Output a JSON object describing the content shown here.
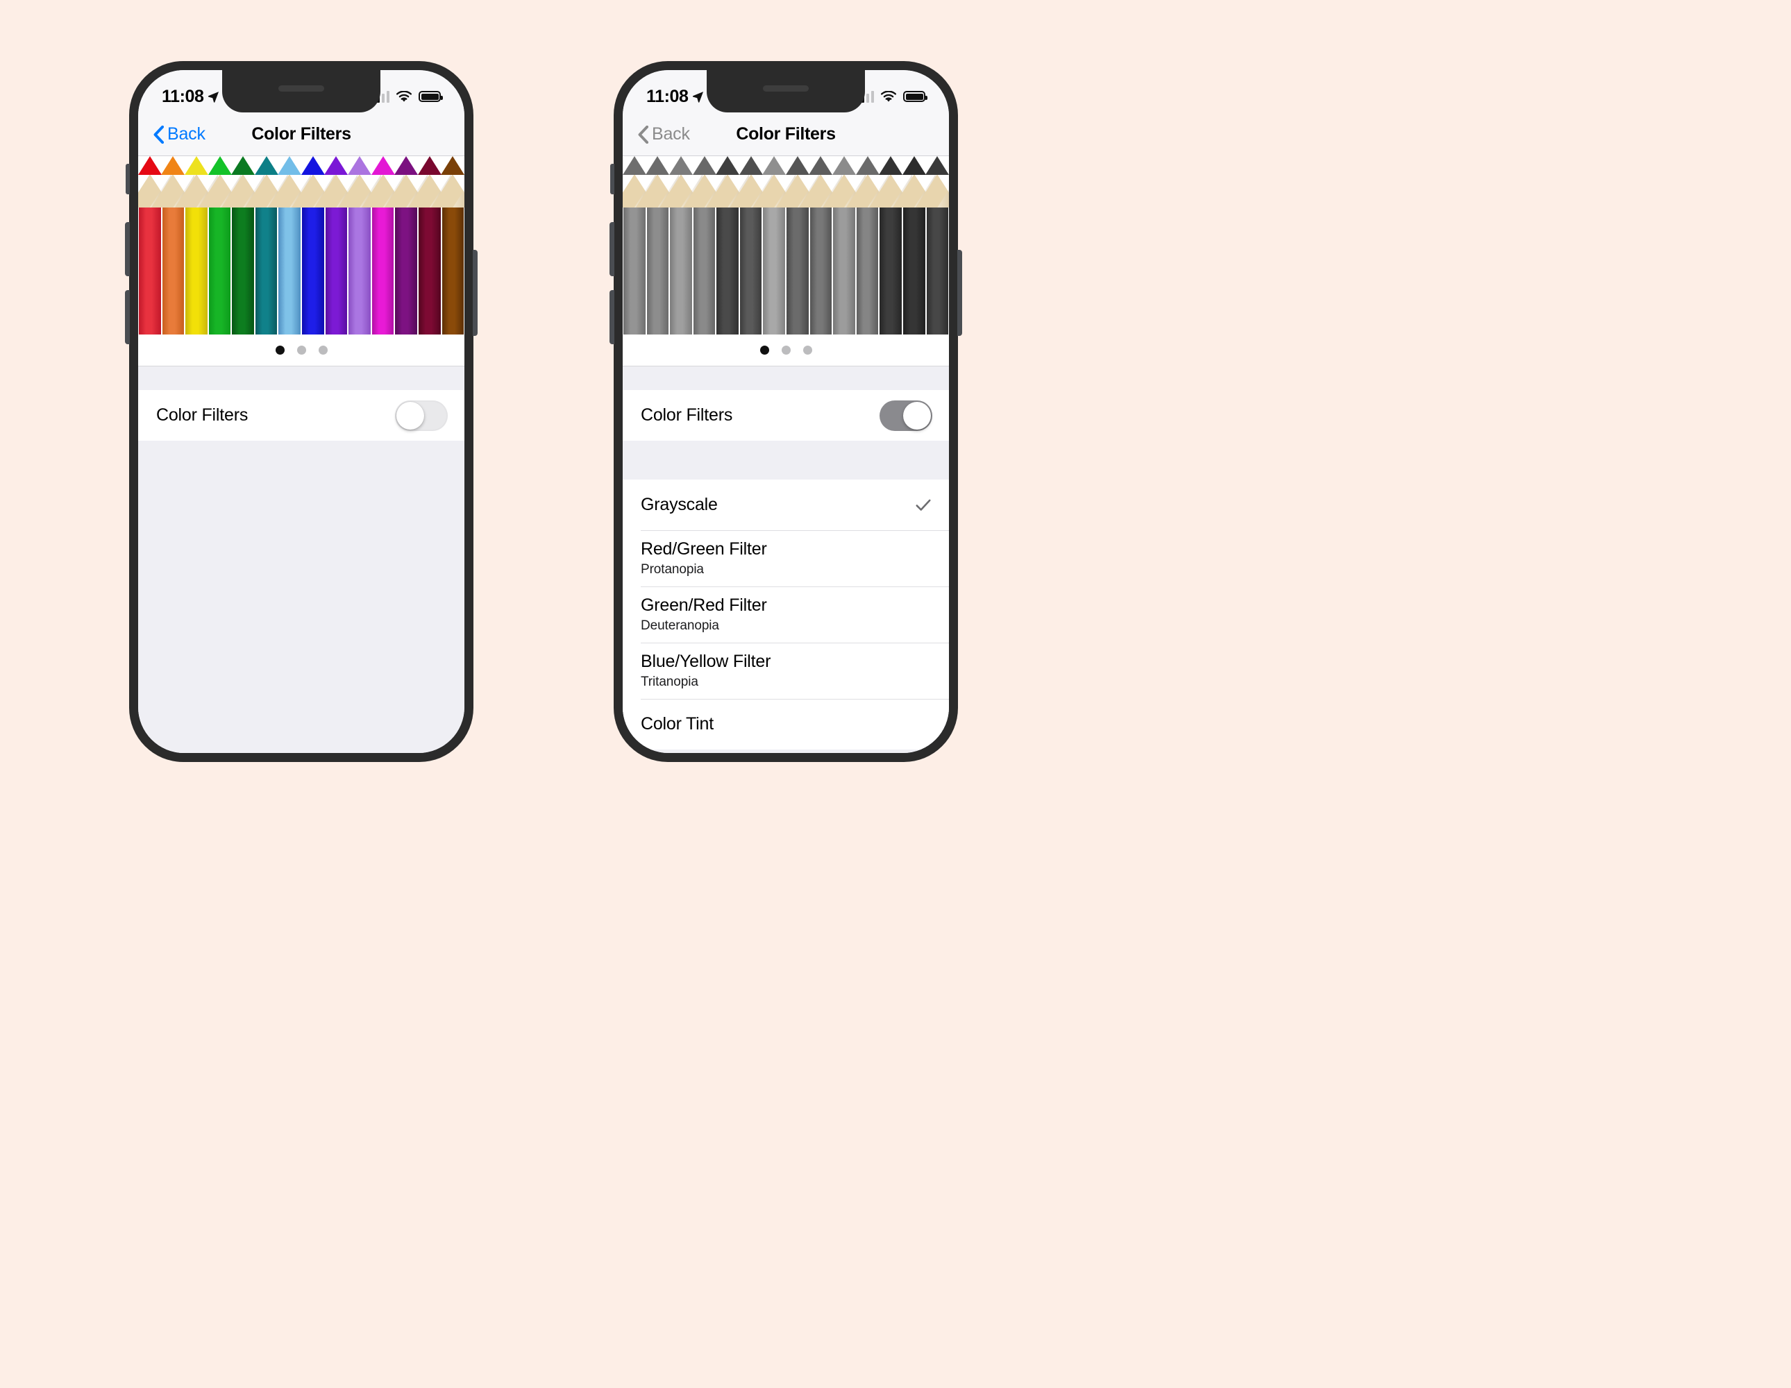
{
  "background_color": "#fdeee6",
  "phones": [
    {
      "id": "phone-color",
      "mode": "color",
      "status_bar": {
        "time": "11:08",
        "location_icon": "location-arrow-icon",
        "signal_icon": "cellular-signal-icon",
        "wifi_icon": "wifi-icon",
        "battery_icon": "battery-full-icon"
      },
      "nav": {
        "back_label": "Back",
        "back_icon": "chevron-left-icon",
        "title": "Color Filters",
        "back_color": "#007aff"
      },
      "banner": {
        "name": "color-pencils-preview",
        "page_dots": {
          "count": 3,
          "active_index": 0
        },
        "pencils": [
          {
            "name": "red",
            "tip": "#e50914",
            "body": "#e8323f",
            "body2": "#c2182a"
          },
          {
            "name": "orange",
            "tip": "#f08416",
            "body": "#e87b3a",
            "body2": "#c85f1e"
          },
          {
            "name": "yellow",
            "tip": "#ede11f",
            "body": "#f2e008",
            "body2": "#c9b70a"
          },
          {
            "name": "green",
            "tip": "#14c229",
            "body": "#17b526",
            "body2": "#0d9c1c"
          },
          {
            "name": "dark-green",
            "tip": "#0b7a22",
            "body": "#0d7d1f",
            "body2": "#075615"
          },
          {
            "name": "teal",
            "tip": "#0c7f86",
            "body": "#10818a",
            "body2": "#0a5a60"
          },
          {
            "name": "light-blue",
            "tip": "#72bde8",
            "body": "#7fc2e8",
            "body2": "#4f8fc2"
          },
          {
            "name": "blue",
            "tip": "#1414e0",
            "body": "#1e1ee8",
            "body2": "#0e0eb0"
          },
          {
            "name": "purple",
            "tip": "#7a17d6",
            "body": "#7c1ad4",
            "body2": "#5a0fa0"
          },
          {
            "name": "light-purple",
            "tip": "#ab74e0",
            "body": "#aa76e2",
            "body2": "#8a4fc4"
          },
          {
            "name": "magenta",
            "tip": "#e318d4",
            "body": "#e81ad6",
            "body2": "#b210a6"
          },
          {
            "name": "dark-purple",
            "tip": "#7b1080",
            "body": "#7d1282",
            "body2": "#550a58"
          },
          {
            "name": "maroon",
            "tip": "#79082f",
            "body": "#7d0a33",
            "body2": "#540520"
          },
          {
            "name": "brown",
            "tip": "#7a4008",
            "body": "#8a4a09",
            "body2": "#5d3005"
          }
        ]
      },
      "settings": {
        "toggle_row": {
          "label": "Color Filters",
          "enabled": false
        },
        "options": []
      }
    },
    {
      "id": "phone-grayscale",
      "mode": "grayscale",
      "status_bar": {
        "time": "11:08",
        "location_icon": "location-arrow-icon",
        "signal_icon": "cellular-signal-icon",
        "wifi_icon": "wifi-icon",
        "battery_icon": "battery-full-icon"
      },
      "nav": {
        "back_label": "Back",
        "back_icon": "chevron-left-icon",
        "title": "Color Filters",
        "back_color": "#8b8b8b"
      },
      "banner": {
        "name": "grayscale-pencils-preview",
        "page_dots": {
          "count": 3,
          "active_index": 0
        },
        "pencils": [
          {
            "name": "gray-1",
            "tip": "#6e6e6e",
            "body": "#949494",
            "body2": "#6f6f6f"
          },
          {
            "name": "gray-2",
            "tip": "#6b6b6b",
            "body": "#8d8d8d",
            "body2": "#6a6a6a"
          },
          {
            "name": "gray-3",
            "tip": "#7c7c7c",
            "body": "#9f9f9f",
            "body2": "#7c7c7c"
          },
          {
            "name": "gray-4",
            "tip": "#686868",
            "body": "#8a8a8a",
            "body2": "#676767"
          },
          {
            "name": "gray-5",
            "tip": "#3f3f3f",
            "body": "#4a4a4a",
            "body2": "#303030"
          },
          {
            "name": "gray-6",
            "tip": "#4f4f4f",
            "body": "#5a5a5a",
            "body2": "#3d3d3d"
          },
          {
            "name": "gray-7",
            "tip": "#8f8f8f",
            "body": "#a8a8a8",
            "body2": "#828282"
          },
          {
            "name": "gray-8",
            "tip": "#555555",
            "body": "#6b6b6b",
            "body2": "#494949"
          },
          {
            "name": "gray-9",
            "tip": "#5e5e5e",
            "body": "#787878",
            "body2": "#545454"
          },
          {
            "name": "gray-10",
            "tip": "#8b8b8b",
            "body": "#9c9c9c",
            "body2": "#777777"
          },
          {
            "name": "gray-11",
            "tip": "#6a6a6a",
            "body": "#858585",
            "body2": "#5e5e5e"
          },
          {
            "name": "gray-12",
            "tip": "#333333",
            "body": "#3d3d3d",
            "body2": "#262626"
          },
          {
            "name": "gray-13",
            "tip": "#2c2c2c",
            "body": "#353535",
            "body2": "#1f1f1f"
          },
          {
            "name": "gray-14",
            "tip": "#3a3a3a",
            "body": "#474747",
            "body2": "#2d2d2d"
          }
        ]
      },
      "settings": {
        "toggle_row": {
          "label": "Color Filters",
          "enabled": true
        },
        "options": [
          {
            "label": "Grayscale",
            "sub": "",
            "selected": true
          },
          {
            "label": "Red/Green Filter",
            "sub": "Protanopia",
            "selected": false
          },
          {
            "label": "Green/Red Filter",
            "sub": "Deuteranopia",
            "selected": false
          },
          {
            "label": "Blue/Yellow Filter",
            "sub": "Tritanopia",
            "selected": false
          },
          {
            "label": "Color Tint",
            "sub": "",
            "selected": false
          }
        ]
      }
    }
  ]
}
